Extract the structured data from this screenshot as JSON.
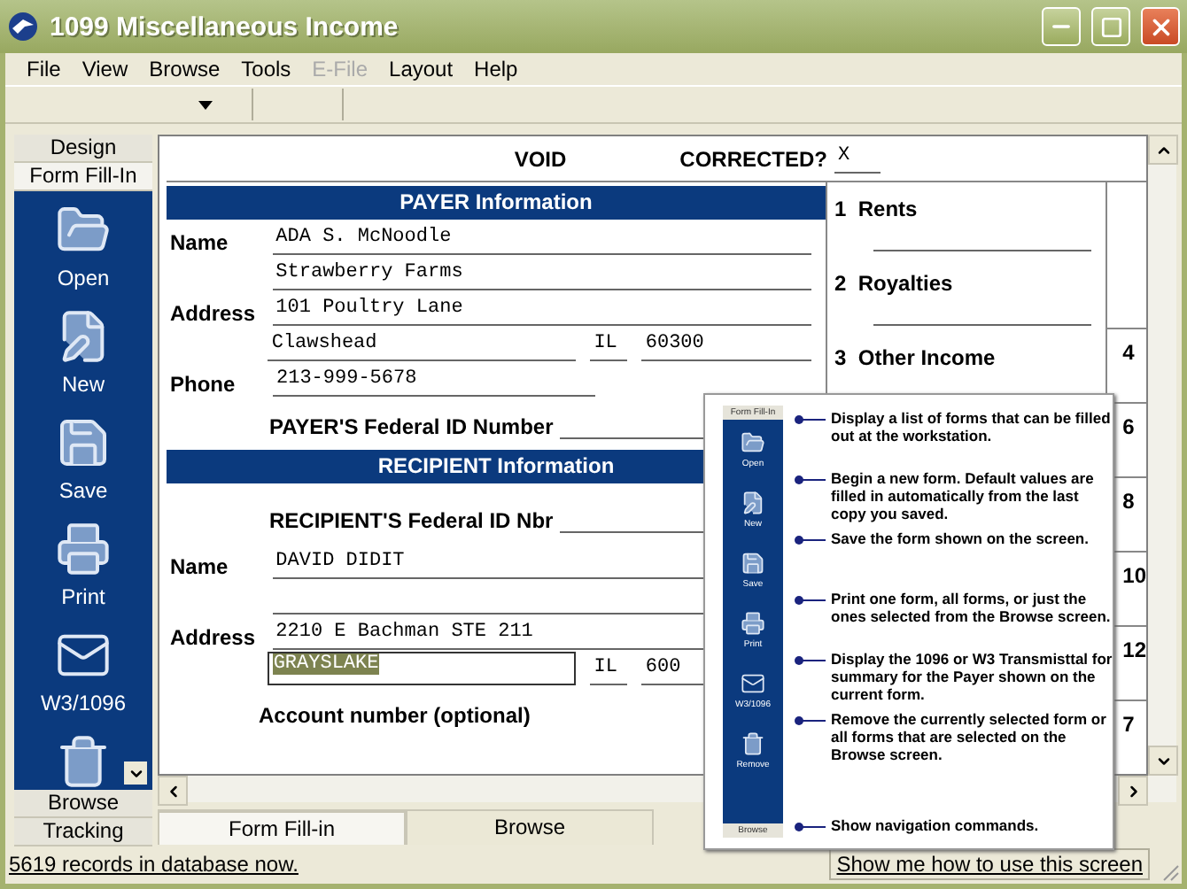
{
  "window": {
    "title": "1099 Miscellaneous Income"
  },
  "menu": [
    {
      "label": "File",
      "disabled": false
    },
    {
      "label": "View",
      "disabled": false
    },
    {
      "label": "Browse",
      "disabled": false
    },
    {
      "label": "Tools",
      "disabled": false
    },
    {
      "label": "E-File",
      "disabled": true
    },
    {
      "label": "Layout",
      "disabled": false
    },
    {
      "label": "Help",
      "disabled": false
    }
  ],
  "sidebar": {
    "top_tabs": [
      {
        "label": "Design",
        "selected": false
      },
      {
        "label": "Form Fill-In",
        "selected": true
      }
    ],
    "tools": [
      {
        "kind": "open",
        "label": "Open"
      },
      {
        "kind": "new",
        "label": "New"
      },
      {
        "kind": "save",
        "label": "Save"
      },
      {
        "kind": "print",
        "label": "Print"
      },
      {
        "kind": "mail",
        "label": "W3/1096"
      },
      {
        "kind": "trash"
      }
    ],
    "bottom_tabs": [
      {
        "label": "Browse",
        "selected": false
      },
      {
        "label": "Tracking",
        "selected": false
      }
    ]
  },
  "form": {
    "void_label": "VOID",
    "corrected_label": "CORRECTED?",
    "corrected_value": "X",
    "payer": {
      "header": "PAYER Information",
      "rows": [
        {
          "label": "Name",
          "value": "ADA S. McNoodle"
        },
        {
          "label": "",
          "value": "Strawberry Farms"
        },
        {
          "label": "Address",
          "value": "101 Poultry Lane"
        },
        {
          "label": "",
          "value": "Clawshead",
          "state": "IL",
          "zip": "60300"
        },
        {
          "label": "Phone",
          "value": "213-999-5678"
        }
      ],
      "id_label": "PAYER'S Federal ID Number"
    },
    "recipient": {
      "header": "RECIPIENT Information",
      "id_label": "RECIPIENT'S Federal ID Nbr",
      "rows": [
        {
          "label": "Name",
          "value": "DAVID DIDIT"
        },
        {
          "label": "",
          "value": ""
        },
        {
          "label": "Address",
          "value": "2210 E Bachman STE 211"
        },
        {
          "label": "",
          "value": "GRAYSLAKE",
          "state": "IL",
          "zip": "600",
          "selected": true
        }
      ],
      "account_label": "Account number (optional)"
    },
    "boxes": [
      {
        "number": "1",
        "label": "Rents"
      },
      {
        "number": "2",
        "label": "Royalties"
      },
      {
        "number": "3",
        "label": "Other Income"
      }
    ],
    "side_numbers": [
      "4",
      "6",
      "8",
      "10",
      "12",
      "7"
    ]
  },
  "bottom_tabs": [
    {
      "label": "Form Fill-in",
      "selected": true
    },
    {
      "label": "Browse",
      "selected": false
    }
  ],
  "status_bar": {
    "records": "5619 records in database now.",
    "help_link": "Show me how to use this screen"
  },
  "help_overlay": {
    "header": "Form Fill-In",
    "items": [
      {
        "kind": "open",
        "label": "Open",
        "description": "Display a list of forms that can be filled out at the workstation."
      },
      {
        "kind": "new",
        "label": "New",
        "description": "Begin a new form. Default values are filled in automatically from the last copy you saved."
      },
      {
        "kind": "save",
        "label": "Save",
        "description": "Save the form shown on the screen."
      },
      {
        "kind": "print",
        "label": "Print",
        "description": "Print one form, all forms, or just the ones selected from the Browse screen."
      },
      {
        "kind": "mail",
        "label": "W3/1096",
        "description": "Display the 1096 or W3 Transmisttal for summary for the Payer shown on the current form."
      },
      {
        "kind": "trash",
        "label": "Remove",
        "description": "Remove the currently selected form or all forms that are selected on the Browse screen."
      }
    ],
    "footer": {
      "label": "Browse",
      "description": "Show navigation commands."
    }
  }
}
